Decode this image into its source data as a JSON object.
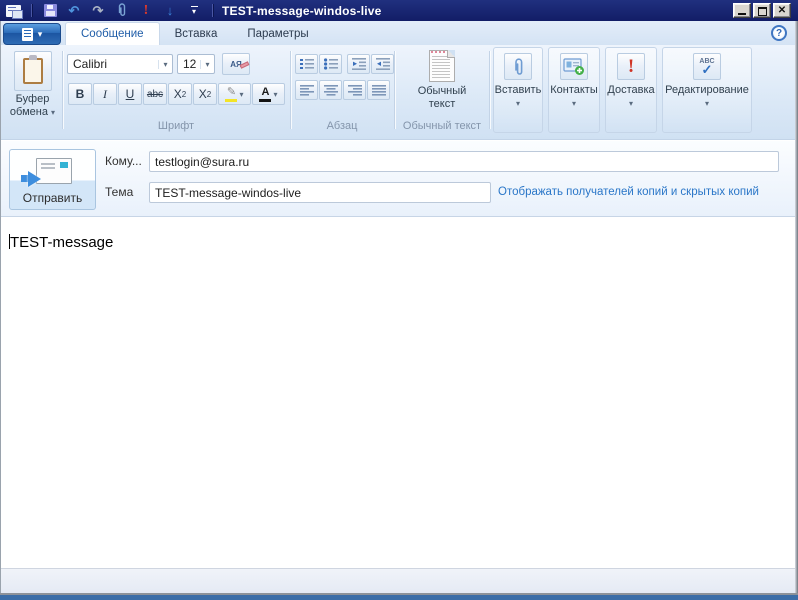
{
  "window": {
    "title": "TEST-message-windos-live"
  },
  "icons": {
    "dropdown": "▾",
    "undo": "↶",
    "redo": "↷",
    "importance": "!",
    "send_down": "↓",
    "close": "✕",
    "help": "?",
    "clear_format": "АЯ",
    "highlight_pen": "✎",
    "font_color_letter": "A",
    "spellcheck_text": "ABC",
    "spellcheck_check": "✓"
  },
  "tabs": [
    {
      "label": "Сообщение",
      "active": true
    },
    {
      "label": "Вставка",
      "active": false
    },
    {
      "label": "Параметры",
      "active": false
    }
  ],
  "ribbon": {
    "clipboard": {
      "line1": "Буфер",
      "line2": "обмена"
    },
    "font": {
      "group_label": "Шрифт",
      "family": "Calibri",
      "size": "12",
      "bold": "B",
      "italic": "I",
      "underline": "U",
      "strikethrough": "abc",
      "subscript_base": "X",
      "subscript_mark": "2",
      "superscript_base": "X",
      "superscript_mark": "2"
    },
    "paragraph": {
      "group_label": "Абзац"
    },
    "plain_text": {
      "group_label": "Обычный текст",
      "button_line1": "Обычный",
      "button_line2": "текст"
    },
    "insert": {
      "label": "Вставить"
    },
    "contacts": {
      "label": "Контакты"
    },
    "delivery": {
      "label": "Доставка"
    },
    "editing": {
      "label": "Редактирование"
    }
  },
  "compose": {
    "send_label": "Отправить",
    "to_label": "Кому...",
    "to_value": "testlogin@sura.ru",
    "subject_label": "Тема",
    "subject_value": "TEST-message-windos-live",
    "cc_bcc_link": "Отображать получателей копий и скрытых копий",
    "body_text": "TEST-message"
  },
  "colors": {
    "titlebar": "#16226e",
    "link_blue": "#2a76c8",
    "bottom_strip": "#3c6da7",
    "active_tab_text": "#1f5da8"
  }
}
